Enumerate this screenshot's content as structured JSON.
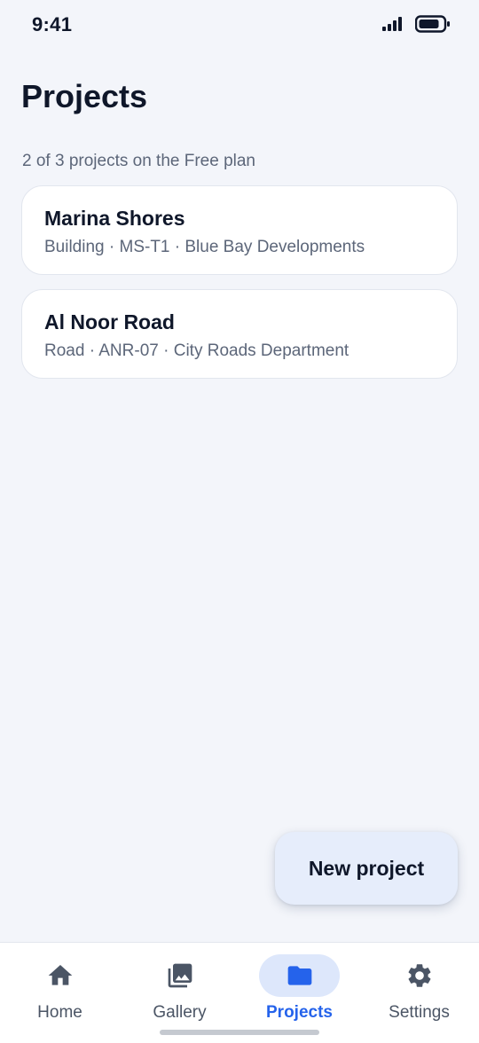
{
  "status_bar": {
    "time": "9:41",
    "signal_icon": "cellular-signal-icon",
    "battery_icon": "battery-icon"
  },
  "header": {
    "title": "Projects",
    "plan_info": "2 of 3 projects on the Free plan"
  },
  "projects": [
    {
      "name": "Marina Shores",
      "meta": "Building · MS-T1 · Blue Bay Developments"
    },
    {
      "name": "Al Noor Road",
      "meta": "Road · ANR-07 · City Roads Department"
    }
  ],
  "fab": {
    "label": "New project"
  },
  "bottom_nav": {
    "items": [
      {
        "label": "Home",
        "icon": "home-icon",
        "active": false
      },
      {
        "label": "Gallery",
        "icon": "gallery-icon",
        "active": false
      },
      {
        "label": "Projects",
        "icon": "folder-icon",
        "active": true
      },
      {
        "label": "Settings",
        "icon": "gear-icon",
        "active": false
      }
    ]
  },
  "colors": {
    "background": "#f3f5fa",
    "accent": "#2563eb",
    "active_pill": "#dde7fb",
    "fab_background": "#e6edfb",
    "text_primary": "#0f172a",
    "text_secondary": "#5c6679"
  }
}
